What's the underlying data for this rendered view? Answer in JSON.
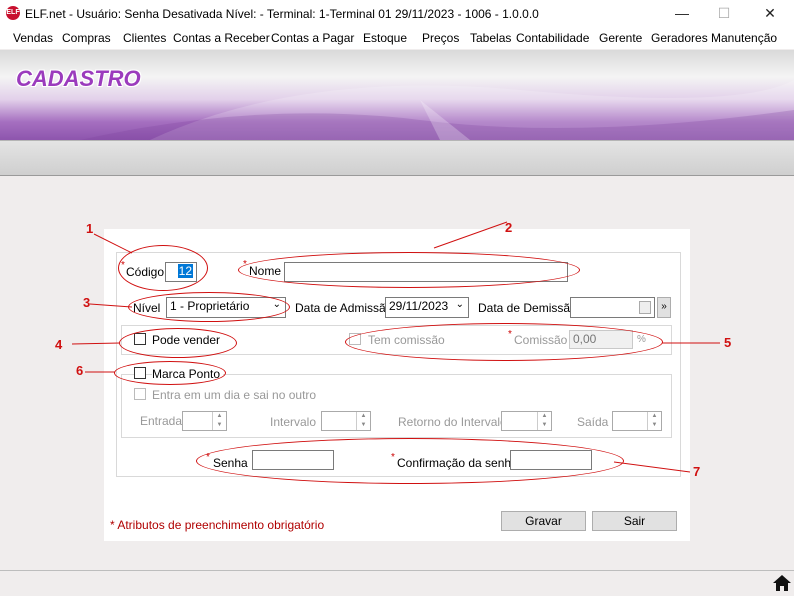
{
  "window": {
    "logo_text": "ELF",
    "title": "ELF.net -   Usuário: Senha Desativada   Nível: -    Terminal: 1-Terminal 01    29/11/2023 - 1006 - 1.0.0.0",
    "minimize": "—",
    "maximize": "☐",
    "close": "✕"
  },
  "menu": [
    "Vendas",
    "Compras",
    "Clientes",
    "Contas a Receber",
    "Contas a Pagar",
    "Estoque",
    "Preços",
    "Tabelas",
    "Contabilidade",
    "Gerente",
    "Geradores",
    "Manutenção"
  ],
  "banner": {
    "title": "CADASTRO"
  },
  "form": {
    "codigo_label": "Código",
    "codigo_value": "12",
    "nome_label": "Nome",
    "nome_value": "",
    "nivel_label": "Nível",
    "nivel_value": "1 - Proprietário",
    "admissao_label": "Data de Admissão",
    "admissao_value": "29/11/2023",
    "demissao_label": "Data de Demissão",
    "demissao_value": "",
    "demissao_btn": "»",
    "pode_vender_label": "Pode vender",
    "tem_comissao_label": "Tem comissão",
    "comissao_label": "Comissão",
    "comissao_value": "0,00",
    "comissao_unit": "%",
    "marca_ponto_label": "Marca Ponto",
    "entra_label": "Entra em um dia e sai no outro",
    "entrada_label": "Entrada",
    "intervalo_label": "Intervalo",
    "retorno_label": "Retorno do Intervalo",
    "saida_label": "Saída",
    "senha_label": "Senha",
    "confirmacao_label": "Confirmação da senha",
    "required_note": "* Atributos de preenchimento obrigatório",
    "required_mark": "*",
    "gravar": "Gravar",
    "sair": "Sair"
  },
  "annotations": [
    "1",
    "2",
    "3",
    "4",
    "5",
    "6",
    "7"
  ],
  "colors": {
    "annotation": "#d01010",
    "banner_title": "#9b3bbd",
    "required": "#cc0000"
  },
  "icons": {
    "home": "home-icon"
  }
}
